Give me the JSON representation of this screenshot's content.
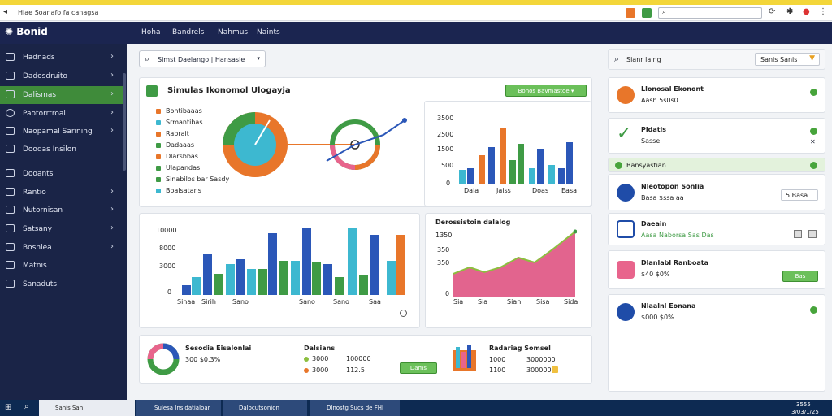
{
  "browser": {
    "tab_title": "Hiae Soanafo fa canagsa",
    "back_icon": "back-arrow-icon",
    "url_icon": "search-icon"
  },
  "header": {
    "logo": "Bonid",
    "nav": [
      "Hoha",
      "Bandrels",
      "Nahmus",
      "Naints"
    ]
  },
  "sidebar": {
    "items": [
      {
        "label": "Hadnads",
        "icon": "grid-icon",
        "chevron": true
      },
      {
        "label": "Dadosdruito",
        "icon": "document-icon",
        "chevron": true
      },
      {
        "label": "Dalismas",
        "icon": "calendar-icon",
        "chevron": true,
        "active": true
      },
      {
        "label": "Paotorrtroal",
        "icon": "circle-icon",
        "chevron": true
      },
      {
        "label": "Naopamal Sarining",
        "icon": "chat-icon",
        "chevron": true
      },
      {
        "label": "Doodas Insilon",
        "icon": "report-icon",
        "chevron": false
      },
      {
        "label": "Dooants",
        "icon": "tag-icon",
        "chevron": false
      },
      {
        "label": "Rantio",
        "icon": "folder-icon",
        "chevron": true
      },
      {
        "label": "Nutornisan",
        "icon": "box-icon",
        "chevron": true
      },
      {
        "label": "Satsany",
        "icon": "bank-icon",
        "chevron": true
      },
      {
        "label": "Bosniea",
        "icon": "table-icon",
        "chevron": true
      },
      {
        "label": "Matnis",
        "icon": "grid-icon",
        "chevron": false
      },
      {
        "label": "Sanaduts",
        "icon": "square-icon",
        "chevron": false
      }
    ]
  },
  "main": {
    "search": {
      "text": "Simst Daelango",
      "filter": "Hansasle"
    },
    "overview": {
      "title": "Simulas Ikonomol Ulogayja",
      "button": "Bonos Bavmastoe",
      "legend": [
        {
          "label": "Bontibaaas",
          "color": "#e8762a"
        },
        {
          "label": "Srmantibas",
          "color": "#3db8d0"
        },
        {
          "label": "Rabrait",
          "color": "#e8762a"
        },
        {
          "label": "Dadaaas",
          "color": "#3f9b45"
        },
        {
          "label": "Dlarsbbas",
          "color": "#e8762a"
        },
        {
          "label": "Ulapandas",
          "color": "#3f9b45"
        },
        {
          "label": "Sinabilos bar Sasdy",
          "color": "#3f9b45"
        },
        {
          "label": "Boalsatans",
          "color": "#3db8d0"
        }
      ]
    },
    "chart_small": {
      "yticks": [
        "3500",
        "2500",
        "1500",
        "500",
        "0"
      ],
      "xticks": [
        "Daia",
        "Jaiss",
        "Doas",
        "Easa"
      ]
    },
    "chart_mid": {
      "yticks": [
        "10000",
        "8000",
        "3000",
        "0"
      ],
      "xticks": [
        "Sinaa",
        "Sirih",
        "Sano",
        "Sano",
        "Sano",
        "Saa"
      ]
    },
    "chart_area": {
      "title": "Derossistoin dalalog",
      "yticks": [
        "1350",
        "350",
        "350",
        "0"
      ],
      "xticks": [
        "Sia",
        "Sia",
        "Sian",
        "Sisa",
        "Sida"
      ]
    },
    "bottom": {
      "card1_title": "Sesodia Eisalonlai",
      "card1_value": "300 $0.3%",
      "card2_title": "Dalsians",
      "card2_rows": [
        {
          "a": "3000",
          "b": "100000"
        },
        {
          "a": "3000",
          "b": "112.5"
        }
      ],
      "card2_button": "Dams",
      "card3_title": "Radariag Somsel",
      "card3_rows": [
        {
          "a": "1000",
          "b": "3000000"
        },
        {
          "a": "1100",
          "b": "300000"
        }
      ]
    }
  },
  "right_panel": {
    "search_text": "Sianr laing",
    "search_button": "Sanis Sanis",
    "items": [
      {
        "title": "Llonosal Ekonont",
        "sub": "Aash 5s0s0",
        "icon": "info-icon"
      },
      {
        "title": "Pidatls",
        "sub": "Sasse",
        "icon": "check-icon"
      },
      {
        "title": "Bansyastian",
        "sub": "",
        "icon": "green-dot-icon"
      },
      {
        "title": "Nleotopon Sonlia",
        "sub": "Basa $ssa aa",
        "icon": "database-icon",
        "dropdown": "5 Basa"
      },
      {
        "title": "Daeain",
        "sub": "Aasa Naborsa Sas Das",
        "icon": "lock-icon"
      },
      {
        "title": "Dlanlabl Ranboata",
        "sub": "$40 $0%",
        "icon": "bag-icon",
        "button": "Bas"
      },
      {
        "title": "Nlaalnl Eonana",
        "sub": "$000 $0%",
        "icon": "user-icon"
      }
    ]
  },
  "taskbar": {
    "items": [
      "Sanis San",
      "Sulesa Insidatialoar",
      "Dalocutsonion",
      "Dlnostg Sucs de FHI"
    ],
    "time": "3555",
    "date": "3/03/1/25"
  },
  "colors": {
    "accent_green": "#3f8b3a",
    "header_bg": "#1b2550",
    "sidebar_bg": "#1a2447",
    "orange": "#e8762a",
    "teal": "#3db8d0",
    "blue": "#2b57b8",
    "pink": "#e8648c"
  }
}
